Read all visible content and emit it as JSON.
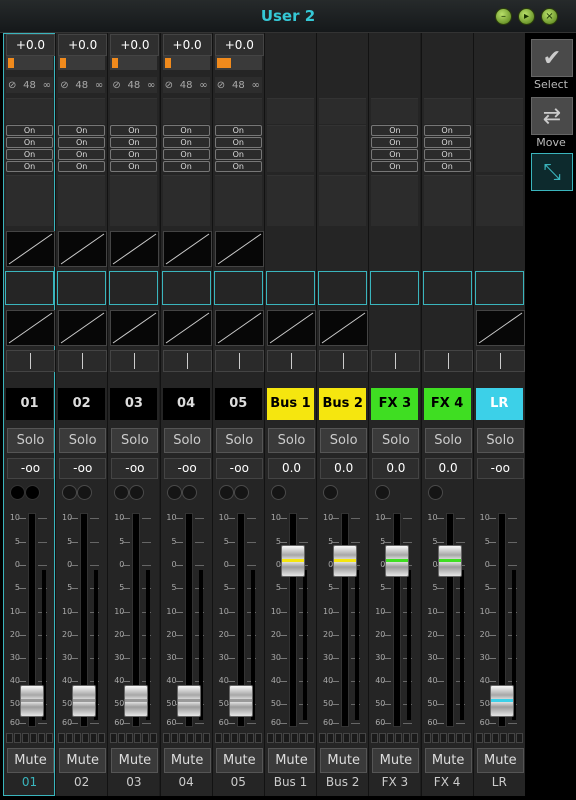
{
  "window": {
    "title": "User 2"
  },
  "side": {
    "select_label": "Select",
    "move_label": "Move"
  },
  "strips": [
    {
      "name": "01",
      "bottom": "01",
      "gain": "+0.0",
      "level": "-oo",
      "solo": "Solo",
      "mute": "Mute",
      "on": [
        "On",
        "On",
        "On",
        "On"
      ],
      "color": "#000000",
      "text_color": "#dddddd",
      "selected": true,
      "kind": "input",
      "fader": 0.0
    },
    {
      "name": "02",
      "bottom": "02",
      "gain": "+0.0",
      "level": "-oo",
      "solo": "Solo",
      "mute": "Mute",
      "on": [
        "On",
        "On",
        "On",
        "On"
      ],
      "color": "#000000",
      "text_color": "#dddddd",
      "selected": false,
      "kind": "input",
      "fader": 0.0
    },
    {
      "name": "03",
      "bottom": "03",
      "gain": "+0.0",
      "level": "-oo",
      "solo": "Solo",
      "mute": "Mute",
      "on": [
        "On",
        "On",
        "On",
        "On"
      ],
      "color": "#000000",
      "text_color": "#dddddd",
      "selected": false,
      "kind": "input",
      "fader": 0.0
    },
    {
      "name": "04",
      "bottom": "04",
      "gain": "+0.0",
      "level": "-oo",
      "solo": "Solo",
      "mute": "Mute",
      "on": [
        "On",
        "On",
        "On",
        "On"
      ],
      "color": "#000000",
      "text_color": "#dddddd",
      "selected": false,
      "kind": "input",
      "fader": 0.0
    },
    {
      "name": "05",
      "bottom": "05",
      "gain": "+0.0",
      "level": "-oo",
      "solo": "Solo",
      "mute": "Mute",
      "on": [
        "On",
        "On",
        "On",
        "On"
      ],
      "color": "#000000",
      "text_color": "#dddddd",
      "selected": false,
      "kind": "input",
      "fader": 0.0
    },
    {
      "name": "Bus 1",
      "bottom": "Bus 1",
      "gain": "",
      "level": "0.0",
      "solo": "Solo",
      "mute": "Mute",
      "on": [],
      "color": "#f5e60f",
      "text_color": "#000000",
      "selected": false,
      "kind": "bus",
      "fader": 0.0
    },
    {
      "name": "Bus 2",
      "bottom": "Bus 2",
      "gain": "",
      "level": "0.0",
      "solo": "Solo",
      "mute": "Mute",
      "on": [],
      "color": "#f5e60f",
      "text_color": "#000000",
      "selected": false,
      "kind": "bus",
      "fader": 0.0
    },
    {
      "name": "FX 3",
      "bottom": "FX 3",
      "gain": "",
      "level": "0.0",
      "solo": "Solo",
      "mute": "Mute",
      "on": [
        "On",
        "On",
        "On",
        "On"
      ],
      "color": "#3fde22",
      "text_color": "#000000",
      "selected": false,
      "kind": "fx",
      "fader": 0.0
    },
    {
      "name": "FX 4",
      "bottom": "FX 4",
      "gain": "",
      "level": "0.0",
      "solo": "Solo",
      "mute": "Mute",
      "on": [
        "On",
        "On",
        "On",
        "On"
      ],
      "color": "#3fde22",
      "text_color": "#000000",
      "selected": false,
      "kind": "fx",
      "fader": 0.0
    },
    {
      "name": "LR",
      "bottom": "LR",
      "gain": "",
      "level": "-oo",
      "solo": "Solo",
      "mute": "Mute",
      "on": [],
      "color": "#3cd0e8",
      "text_color": "#ffffff",
      "selected": false,
      "kind": "main",
      "fader": 0.0
    }
  ],
  "scale": [
    "10",
    "5",
    "0",
    "5",
    "10",
    "20",
    "30",
    "40",
    "50",
    "60"
  ],
  "input_meta": {
    "aux_value": "48"
  }
}
